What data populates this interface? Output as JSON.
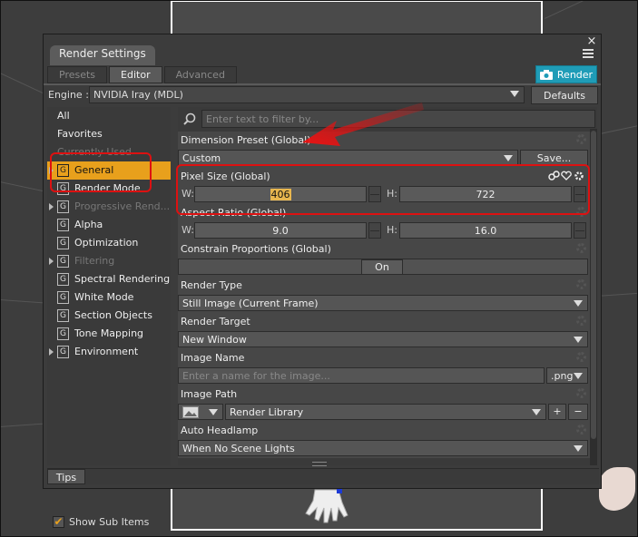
{
  "dialog": {
    "title": "Render Settings",
    "close": "×",
    "tabs": [
      "Presets",
      "Editor",
      "Advanced"
    ],
    "render_label": "Render"
  },
  "engine": {
    "label": "Engine :",
    "value": "NVIDIA Iray (MDL)",
    "defaults_label": "Defaults"
  },
  "categories": [
    {
      "label": "All",
      "selected": false,
      "dim": false
    },
    {
      "label": "Favorites",
      "selected": false,
      "dim": false
    },
    {
      "label": "Currently Used",
      "selected": false,
      "dim": true
    },
    {
      "label": "General",
      "selected": true,
      "dim": false
    },
    {
      "label": "Render Mode",
      "selected": false,
      "dim": false
    },
    {
      "label": "Progressive Rend...",
      "selected": false,
      "dim": true
    },
    {
      "label": "Alpha",
      "selected": false,
      "dim": false
    },
    {
      "label": "Optimization",
      "selected": false,
      "dim": false
    },
    {
      "label": "Filtering",
      "selected": false,
      "dim": true
    },
    {
      "label": "Spectral Rendering",
      "selected": false,
      "dim": false
    },
    {
      "label": "White Mode",
      "selected": false,
      "dim": false
    },
    {
      "label": "Section Objects",
      "selected": false,
      "dim": false
    },
    {
      "label": "Tone Mapping",
      "selected": false,
      "dim": false
    },
    {
      "label": "Environment",
      "selected": false,
      "dim": false
    }
  ],
  "group_icon": "G",
  "show_sub_items": "Show Sub Items",
  "filter_placeholder": "Enter text to filter by...",
  "props": {
    "dimension_preset": {
      "title": "Dimension Preset (Global)",
      "value": "Custom",
      "save": "Save..."
    },
    "pixel_size": {
      "title": "Pixel Size (Global)",
      "w_label": "W:",
      "w": "406",
      "h_label": "H:",
      "h": "722"
    },
    "aspect_ratio": {
      "title": "Aspect Ratio (Global)",
      "w_label": "W:",
      "w": "9.0",
      "h_label": "H:",
      "h": "16.0"
    },
    "constrain": {
      "title": "Constrain Proportions (Global)",
      "value": "On"
    },
    "render_type": {
      "title": "Render Type",
      "value": "Still Image (Current Frame)"
    },
    "render_target": {
      "title": "Render Target",
      "value": "New Window"
    },
    "image_name": {
      "title": "Image Name",
      "placeholder": "Enter a name for the image...",
      "ext": ".png"
    },
    "image_path": {
      "title": "Image Path",
      "value": "Render Library",
      "plus": "+",
      "minus": "−"
    },
    "auto_headlamp": {
      "title": "Auto Headlamp",
      "value": "When No Scene Lights"
    }
  },
  "tips_label": "Tips",
  "colors": {
    "accent": "#e8a01c",
    "render_button": "#1f9cb7",
    "annotation": "#d11111"
  }
}
